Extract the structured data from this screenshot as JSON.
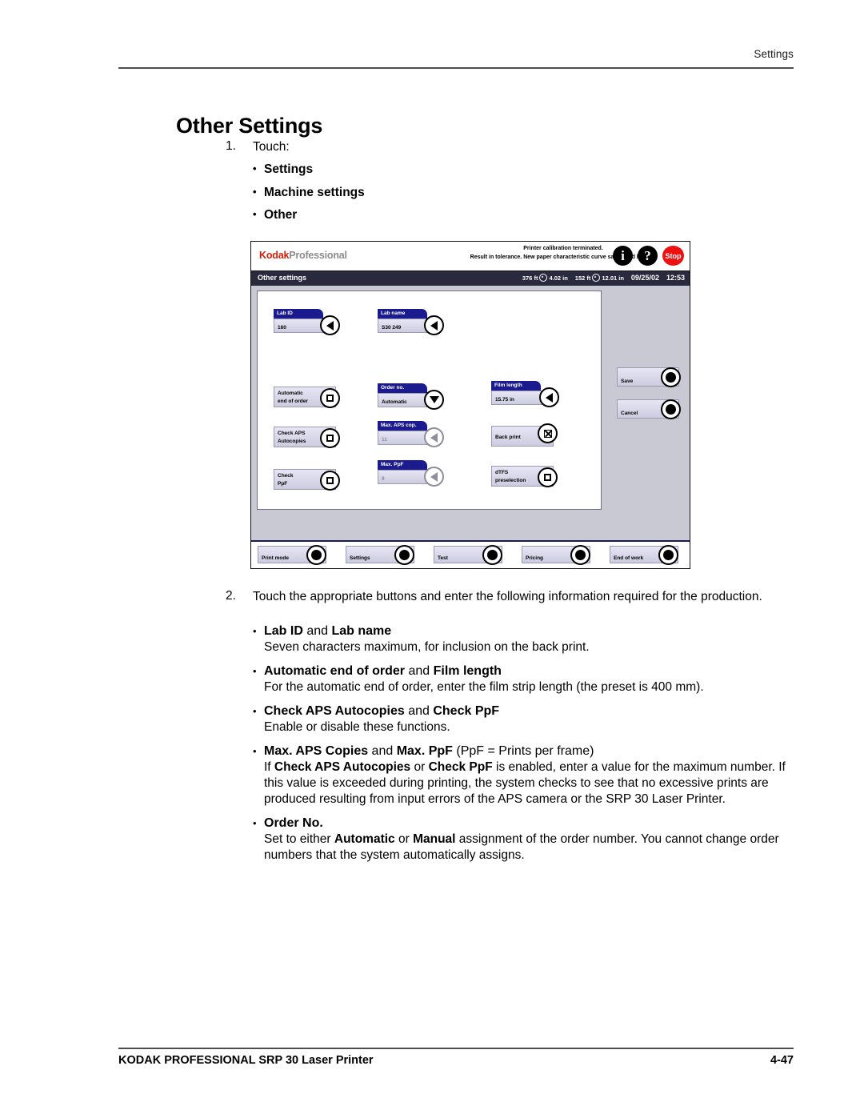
{
  "page": {
    "running_head": "Settings",
    "title": "Other Settings",
    "footer_left": "KODAK PROFESSIONAL SRP 30 Laser Printer",
    "footer_right": "4-47"
  },
  "step1": {
    "number": "1.",
    "text": "Touch:",
    "bullets": [
      {
        "dot": "•",
        "label": "Settings"
      },
      {
        "dot": "•",
        "label": "Machine settings"
      },
      {
        "dot": "•",
        "label": "Other"
      }
    ]
  },
  "step2": {
    "number": "2.",
    "text": "Touch the appropriate buttons and enter the following information required for the production.",
    "items": [
      {
        "dot": "•",
        "lead_bold_1": "Lab ID",
        "lead_mid": " and ",
        "lead_bold_2": "Lab name",
        "lead_tail": "",
        "body": "Seven characters maximum, for inclusion on the back print."
      },
      {
        "dot": "•",
        "lead_bold_1": "Automatic end of order",
        "lead_mid": " and ",
        "lead_bold_2": "Film length",
        "lead_tail": "",
        "body": "For the automatic end of order, enter the film strip length (the preset is 400 mm)."
      },
      {
        "dot": "•",
        "lead_bold_1": "Check APS Autocopies",
        "lead_mid": " and ",
        "lead_bold_2": "Check PpF",
        "lead_tail": "",
        "body": "Enable or disable these functions."
      },
      {
        "dot": "•",
        "lead_bold_1": "Max. APS Copies",
        "lead_mid": " and ",
        "lead_bold_2": "Max. PpF",
        "lead_tail": " (PpF = Prints per frame)",
        "body_part_1": "If ",
        "body_bold_1": "Check APS Autocopies",
        "body_part_2": " or ",
        "body_bold_2": "Check PpF",
        "body_part_3": " is enabled, enter a value for the maximum number. If this value is exceeded during printing, the system checks to see that no excessive prints are produced resulting from input errors of the APS camera or the SRP 30 Laser Printer."
      },
      {
        "dot": "•",
        "lead_bold_1": "Order No.",
        "lead_mid": "",
        "lead_bold_2": "",
        "lead_tail": "",
        "body_part_1": "Set to either ",
        "body_bold_1": "Automatic",
        "body_part_2": " or ",
        "body_bold_2": "Manual",
        "body_part_3": " assignment of the order number. You cannot change order numbers that the system automatically assigns."
      }
    ]
  },
  "screenshot": {
    "brand_primary": "Kodak",
    "brand_secondary": "Professional",
    "brand_color": "#d81e05",
    "message_line_1": "Printer calibration terminated.",
    "message_line_2": "Result in tolerance. New paper characteristic curve saved and loaded.",
    "icons": {
      "info": "i",
      "help": "?",
      "stop": "Stop",
      "stop_color": "#ee1111"
    },
    "status": {
      "title": "Other settings",
      "reel_1_feet": "376 ft",
      "reel_1_inches": "4.02 in",
      "reel_2_feet": "152 ft",
      "reel_2_inches": "12.01 in",
      "date": "09/25/02",
      "time": "12:53"
    },
    "fields": {
      "lab_id": {
        "caption": "Lab ID",
        "value": "160",
        "knob": "arrow-left-icon"
      },
      "lab_name": {
        "caption": "Lab name",
        "value": "S30 249",
        "knob": "arrow-left-icon"
      },
      "automatic_end_of_order": {
        "label_line_1": "Automatic",
        "label_line_2": "end of order",
        "knob": "checkbox-unchecked-icon"
      },
      "order_no": {
        "caption": "Order no.",
        "value": "Automatic",
        "knob": "arrow-down-icon"
      },
      "film_length": {
        "caption": "Film length",
        "value": "15.75 in",
        "knob": "arrow-left-icon"
      },
      "check_aps_autocopies": {
        "label_line_1": "Check APS",
        "label_line_2": "Autocopies",
        "knob": "checkbox-unchecked-icon"
      },
      "max_aps_cop": {
        "caption": "Max. APS cop.",
        "value": "11",
        "knob": "arrow-left-icon",
        "dimmed": true
      },
      "back_print": {
        "label_line_1": "Back print",
        "label_line_2": "",
        "knob": "checkbox-checked-icon"
      },
      "check_ppf": {
        "label_line_1": "Check",
        "label_line_2": "PpF",
        "knob": "checkbox-unchecked-icon"
      },
      "max_ppf": {
        "caption": "Max. PpF",
        "value": "9",
        "knob": "arrow-left-icon",
        "dimmed": true
      },
      "dtfs_preselection": {
        "label_line_1": "dTFS",
        "label_line_2": "preselection",
        "knob": "checkbox-unchecked-icon"
      }
    },
    "side_buttons": [
      {
        "label": "Save",
        "knob": "filled-circle-icon"
      },
      {
        "label": "Cancel",
        "knob": "filled-circle-icon"
      }
    ],
    "nav_buttons": [
      {
        "label": "Print mode",
        "knob": "filled-circle-icon"
      },
      {
        "label": "Settings",
        "knob": "filled-circle-icon"
      },
      {
        "label": "Test",
        "knob": "filled-circle-icon"
      },
      {
        "label": "Pricing",
        "knob": "filled-circle-icon"
      },
      {
        "label": "End of work",
        "knob": "filled-circle-icon"
      }
    ]
  }
}
